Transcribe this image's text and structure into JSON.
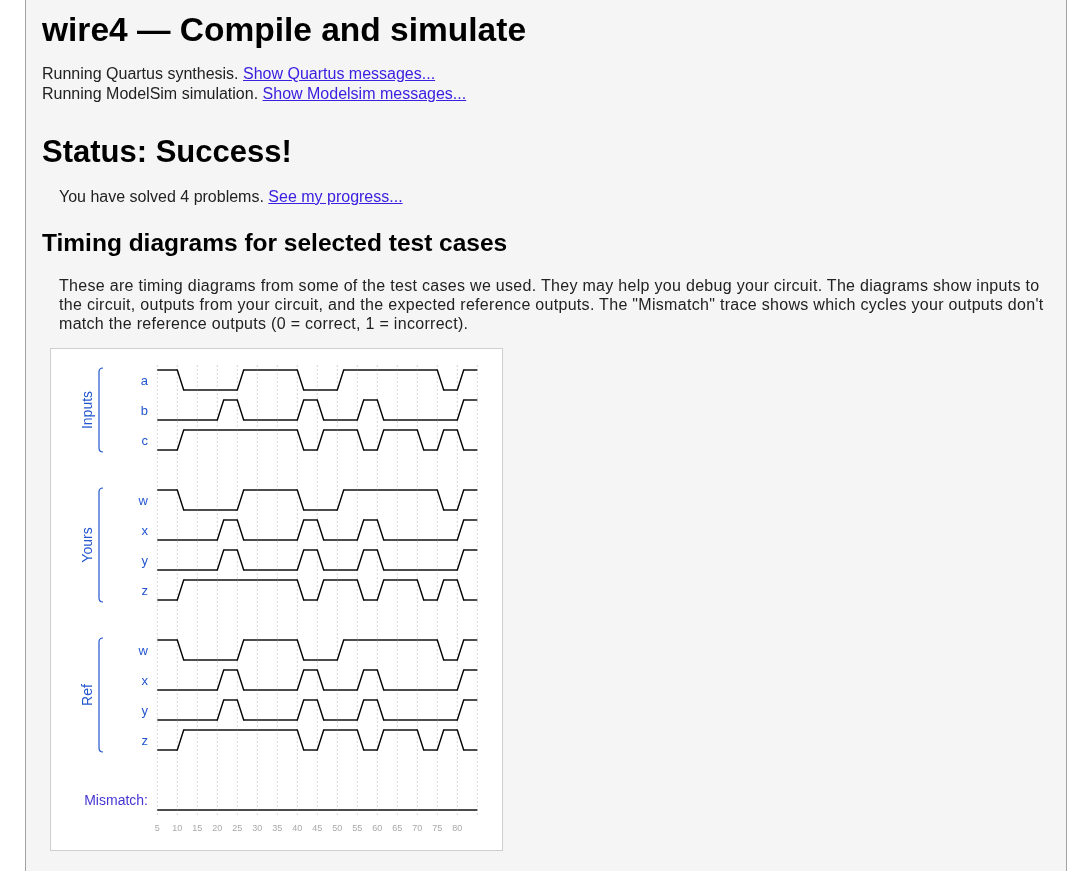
{
  "title": "wire4 — Compile and simulate",
  "log": [
    {
      "text": "Running Quartus synthesis.",
      "link": "Show Quartus messages..."
    },
    {
      "text": "Running ModelSim simulation.",
      "link": "Show Modelsim messages..."
    }
  ],
  "status": "Status: Success!",
  "progress": {
    "text": "You have solved 4 problems.",
    "link": "See my progress..."
  },
  "timing": {
    "heading": "Timing diagrams for selected test cases",
    "description": "These are timing diagrams from some of the test cases we used. They may help you debug your circuit. The diagrams show inputs to the circuit, outputs from your circuit, and the expected reference outputs. The \"Mismatch\" trace shows which cycles your outputs don't match the reference outputs (0 = correct, 1 = incorrect).",
    "groups": [
      {
        "label": "Inputs",
        "signals": [
          {
            "name": "a",
            "high": [
              true,
              false,
              false,
              false,
              true,
              true,
              true,
              false,
              false,
              true,
              true,
              true,
              true,
              true,
              false,
              true
            ]
          },
          {
            "name": "b",
            "high": [
              false,
              false,
              false,
              true,
              false,
              false,
              false,
              true,
              false,
              false,
              true,
              false,
              false,
              false,
              false,
              true
            ]
          },
          {
            "name": "c",
            "high": [
              false,
              true,
              true,
              true,
              true,
              true,
              true,
              false,
              true,
              true,
              false,
              true,
              true,
              false,
              true,
              false
            ]
          }
        ]
      },
      {
        "label": "Yours",
        "signals": [
          {
            "name": "w",
            "high": [
              true,
              false,
              false,
              false,
              true,
              true,
              true,
              false,
              false,
              true,
              true,
              true,
              true,
              true,
              false,
              true
            ]
          },
          {
            "name": "x",
            "high": [
              false,
              false,
              false,
              true,
              false,
              false,
              false,
              true,
              false,
              false,
              true,
              false,
              false,
              false,
              false,
              true
            ]
          },
          {
            "name": "y",
            "high": [
              false,
              false,
              false,
              true,
              false,
              false,
              false,
              true,
              false,
              false,
              true,
              false,
              false,
              false,
              false,
              true
            ]
          },
          {
            "name": "z",
            "high": [
              false,
              true,
              true,
              true,
              true,
              true,
              true,
              false,
              true,
              true,
              false,
              true,
              true,
              false,
              true,
              false
            ]
          }
        ]
      },
      {
        "label": "Ref",
        "signals": [
          {
            "name": "w",
            "high": [
              true,
              false,
              false,
              false,
              true,
              true,
              true,
              false,
              false,
              true,
              true,
              true,
              true,
              true,
              false,
              true
            ]
          },
          {
            "name": "x",
            "high": [
              false,
              false,
              false,
              true,
              false,
              false,
              false,
              true,
              false,
              false,
              true,
              false,
              false,
              false,
              false,
              true
            ]
          },
          {
            "name": "y",
            "high": [
              false,
              false,
              false,
              true,
              false,
              false,
              false,
              true,
              false,
              false,
              true,
              false,
              false,
              false,
              false,
              true
            ]
          },
          {
            "name": "z",
            "high": [
              false,
              true,
              true,
              true,
              true,
              true,
              true,
              false,
              true,
              true,
              false,
              true,
              true,
              false,
              true,
              false
            ]
          }
        ]
      }
    ],
    "mismatch": {
      "name": "Mismatch:",
      "high": [
        false,
        false,
        false,
        false,
        false,
        false,
        false,
        false,
        false,
        false,
        false,
        false,
        false,
        false,
        false,
        false
      ]
    },
    "ticks": [
      "5",
      "10",
      "15",
      "20",
      "25",
      "30",
      "35",
      "40",
      "45",
      "50",
      "55",
      "60",
      "65",
      "70",
      "75",
      "80"
    ]
  }
}
